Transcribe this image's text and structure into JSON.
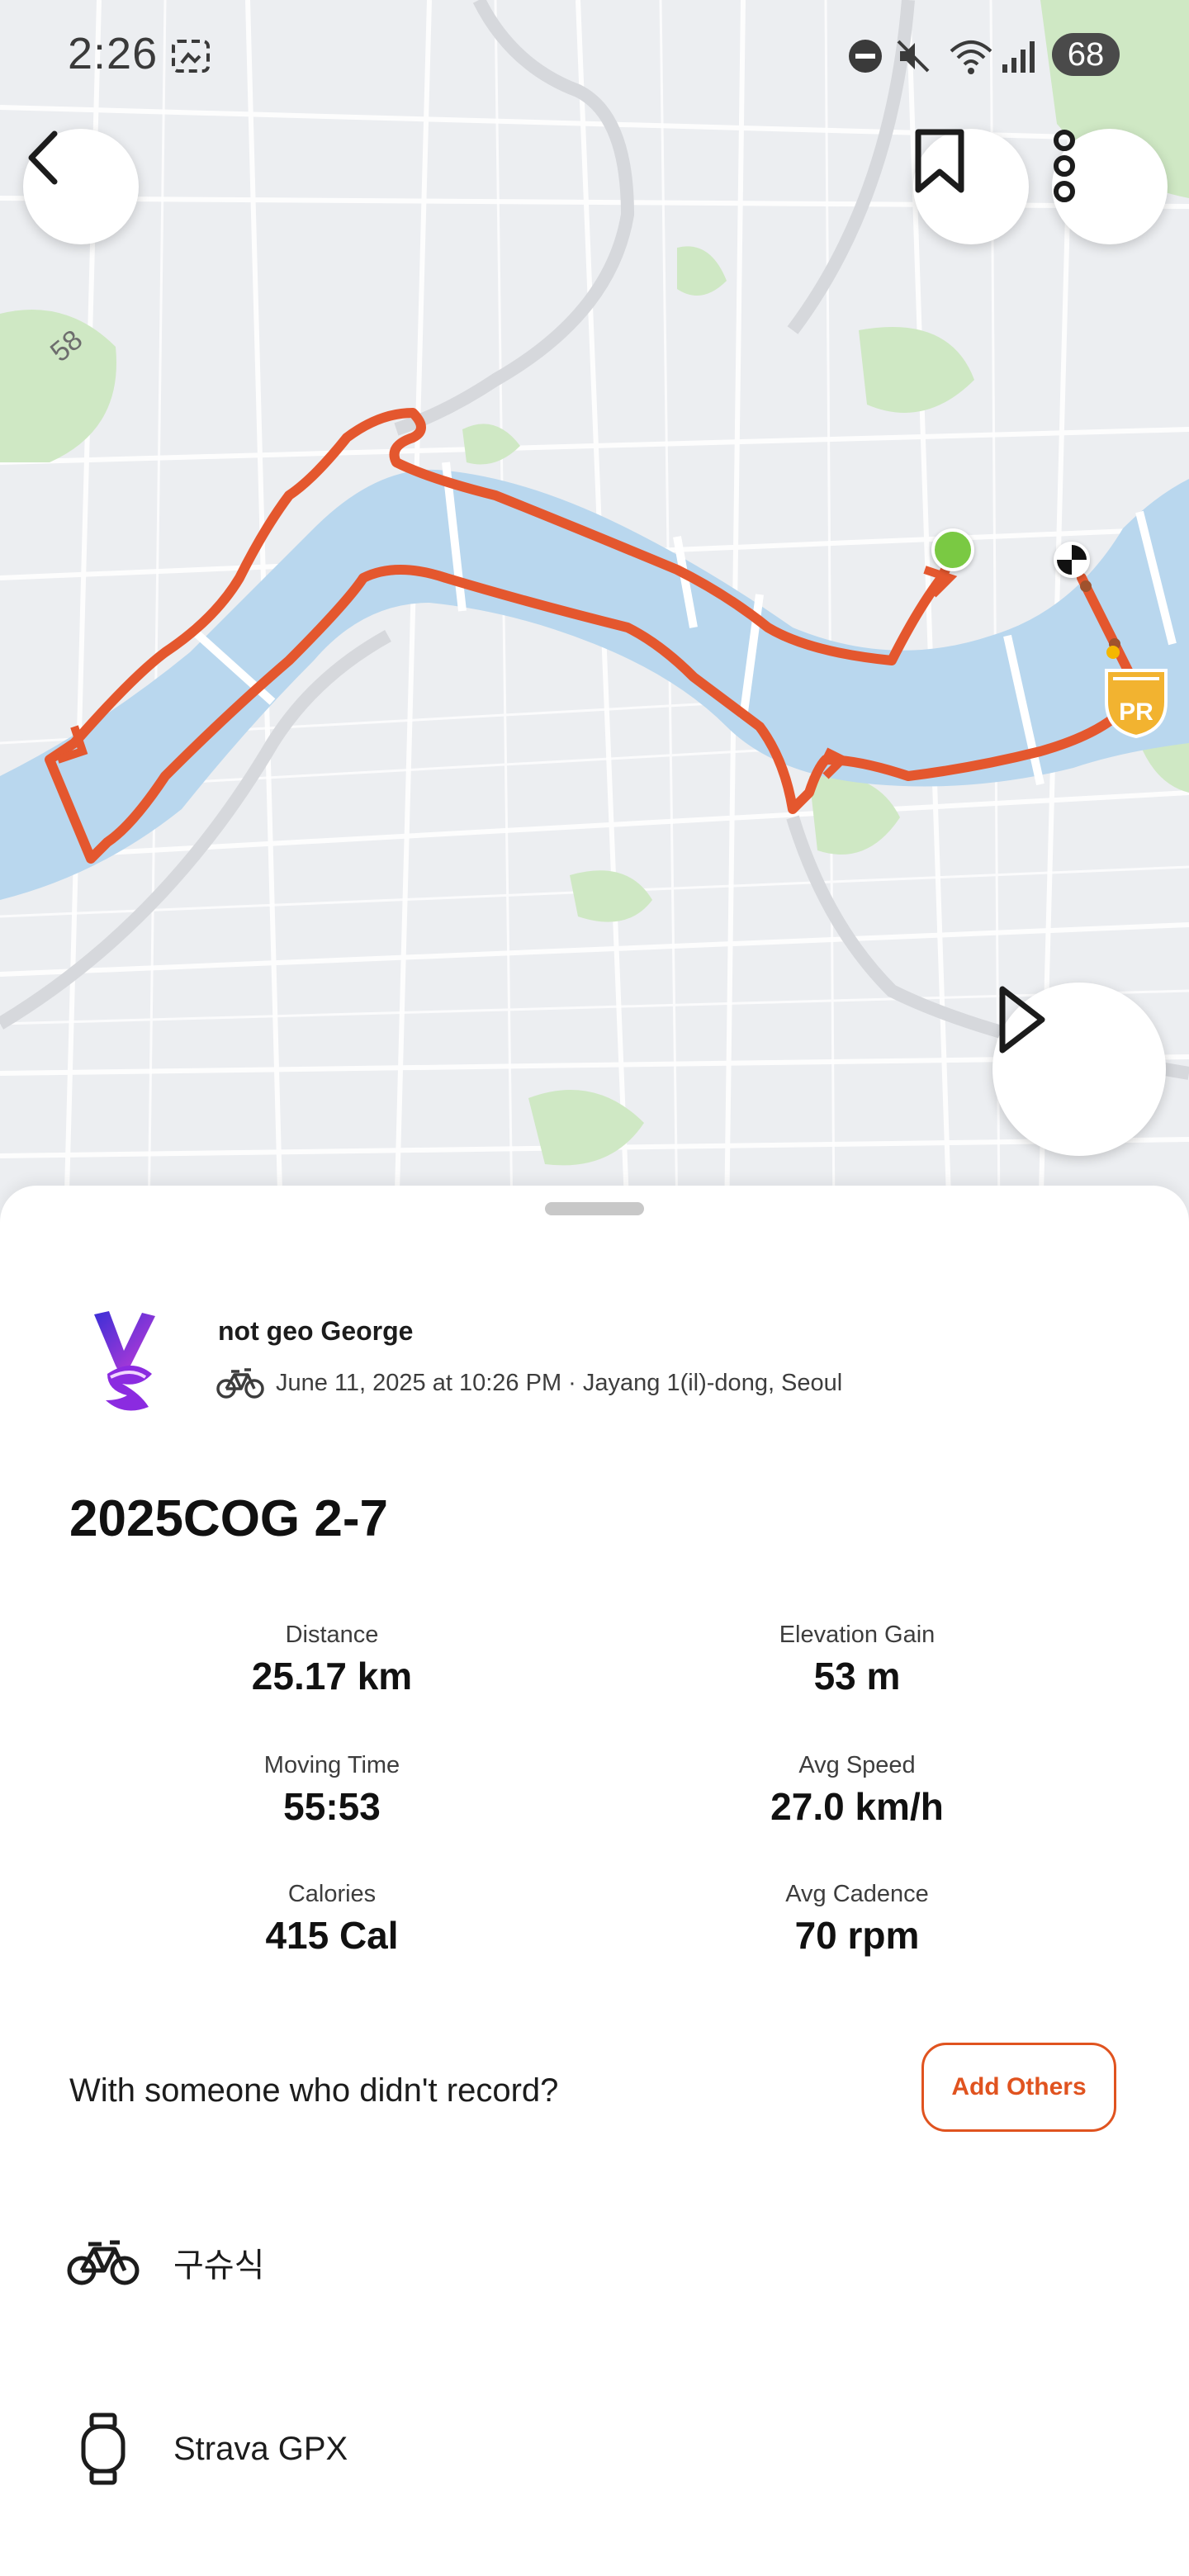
{
  "status_bar": {
    "time": "2:26",
    "battery": "68"
  },
  "map": {
    "road_label": "58",
    "route_color": "#e4572e",
    "start_marker_color": "#7ac943",
    "pr_badge": "PR"
  },
  "activity": {
    "athlete_name": "not geo George",
    "meta": "June 11, 2025 at 10:26 PM · Jayang 1(il)-dong, Seoul",
    "title": "2025COG 2-7",
    "stats": [
      {
        "label": "Distance",
        "value": "25.17 km"
      },
      {
        "label": "Elevation Gain",
        "value": "53 m"
      },
      {
        "label": "Moving Time",
        "value": "55:53"
      },
      {
        "label": "Avg Speed",
        "value": "27.0 km/h"
      },
      {
        "label": "Calories",
        "value": "415 Cal"
      },
      {
        "label": "Avg Cadence",
        "value": "70 rpm"
      }
    ]
  },
  "with_others": {
    "prompt": "With someone who didn't record?",
    "button": "Add Others"
  },
  "gear": [
    {
      "icon": "bike-icon",
      "label": "구슈식"
    },
    {
      "icon": "watch-icon",
      "label": "Strava GPX"
    }
  ],
  "colors": {
    "accent": "#e0531f",
    "river": "#b9d7ee",
    "park": "#cfe8c4"
  }
}
